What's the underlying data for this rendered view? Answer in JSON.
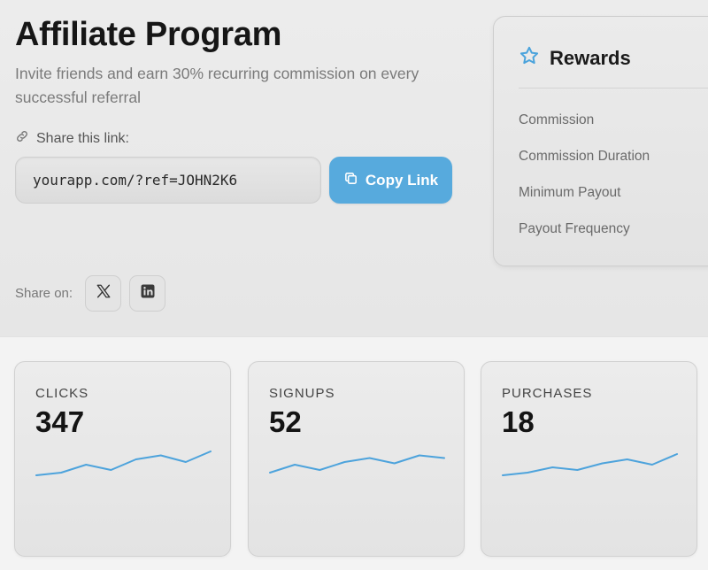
{
  "header": {
    "title": "Affiliate Program",
    "subtitle": "Invite friends and earn 30% recurring commission on every successful referral"
  },
  "share": {
    "label": "Share this link:",
    "link_icon": "link-icon",
    "link_value": "yourapp.com/?ref=JOHN2K6",
    "copy_label": "Copy Link",
    "copy_icon": "copy-icon",
    "share_on_label": "Share on:",
    "socials": [
      {
        "name": "x",
        "icon": "x-logo-icon"
      },
      {
        "name": "linkedin",
        "icon": "linkedin-icon"
      }
    ]
  },
  "rewards": {
    "title": "Rewards",
    "icon": "star-icon",
    "items": [
      "Commission",
      "Commission Duration",
      "Minimum Payout",
      "Payout Frequency"
    ]
  },
  "stats": [
    {
      "label": "CLICKS",
      "value": "347",
      "trend": [
        2,
        3,
        6,
        4,
        8,
        9.5,
        7,
        11
      ]
    },
    {
      "label": "SIGNUPS",
      "value": "52",
      "trend": [
        3,
        6,
        4,
        7,
        8.5,
        6.5,
        9.5,
        8.5
      ]
    },
    {
      "label": "PURCHASES",
      "value": "18",
      "trend": [
        2,
        3,
        5,
        4,
        6.5,
        8,
        6,
        10
      ]
    }
  ],
  "colors": {
    "accent": "#57aadd",
    "sparkline": "#4da3dc",
    "text": "#1c1c1c",
    "muted": "#7a7a7a"
  }
}
